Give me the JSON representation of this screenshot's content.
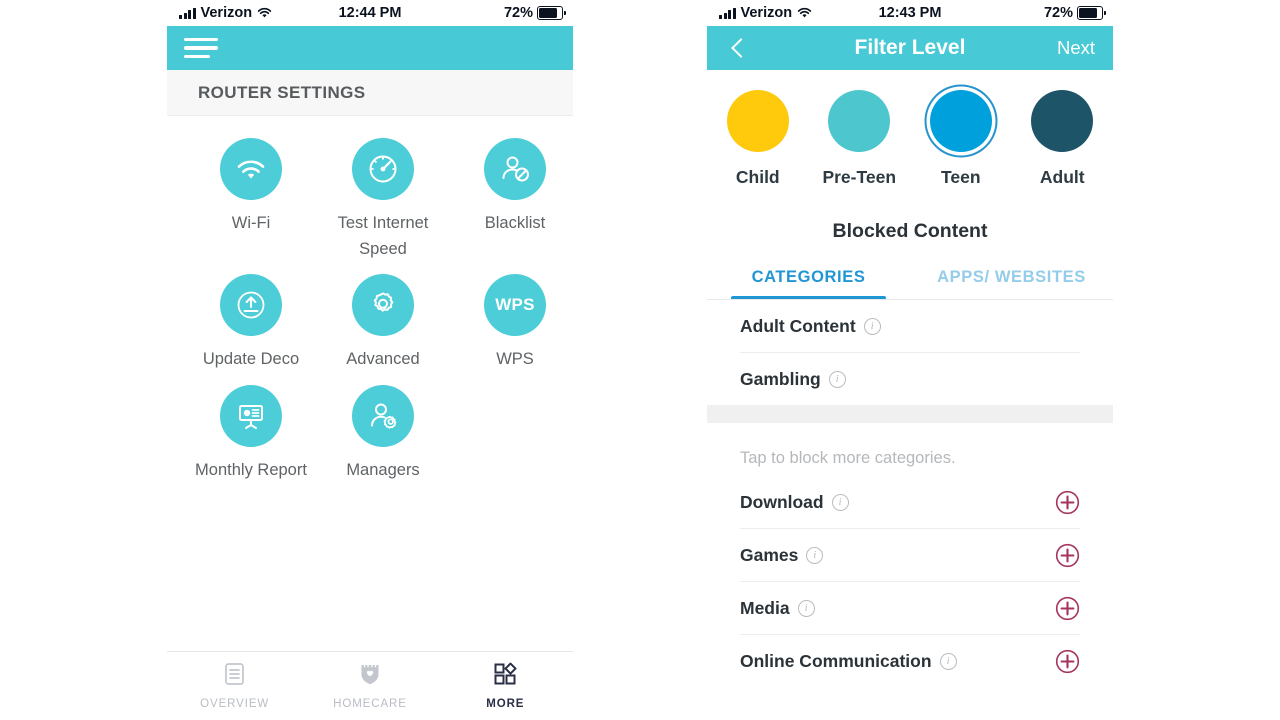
{
  "colors": {
    "teal_header": "#47c9d6",
    "teal_icon": "#4dcdd7",
    "accent_blue": "#2196d4",
    "child_yellow": "#ffc90c",
    "preteen_teal": "#4dc6ce",
    "teen_blue": "#00a0dc",
    "adult_dark": "#1d5468",
    "plus_magenta": "#a5335e",
    "band_gray": "#f0f0f0"
  },
  "left_phone": {
    "status_bar": {
      "carrier": "Verizon",
      "time": "12:44 PM",
      "battery": "72%",
      "signal_icon": "cellular-bars-icon",
      "wifi_icon": "wifi-icon",
      "battery_icon": "battery-icon"
    },
    "header": {
      "menu_icon": "hamburger-menu-icon"
    },
    "section_title": "ROUTER SETTINGS",
    "grid": [
      [
        {
          "label": "Wi-Fi",
          "icon": "wifi-icon"
        },
        {
          "label": "Test Internet Speed",
          "icon": "speedometer-icon"
        },
        {
          "label": "Blacklist",
          "icon": "user-blocked-icon"
        }
      ],
      [
        {
          "label": "Update Deco",
          "icon": "upload-circle-icon"
        },
        {
          "label": "Advanced",
          "icon": "gear-icon"
        },
        {
          "label": "WPS",
          "icon": "wps-text-icon",
          "text": "WPS"
        }
      ],
      [
        {
          "label": "Monthly Report",
          "icon": "presentation-chart-icon"
        },
        {
          "label": "Managers",
          "icon": "user-gear-icon"
        }
      ]
    ],
    "tabbar": [
      {
        "label": "OVERVIEW",
        "icon": "document-lines-icon",
        "active": false
      },
      {
        "label": "HOMECARE",
        "icon": "shield-heart-icon",
        "active": false
      },
      {
        "label": "MORE",
        "icon": "grid-squares-icon",
        "active": true
      }
    ]
  },
  "right_phone": {
    "status_bar": {
      "carrier": "Verizon",
      "time": "12:43 PM",
      "battery": "72%",
      "signal_icon": "cellular-bars-icon",
      "wifi_icon": "wifi-icon",
      "battery_icon": "battery-icon"
    },
    "header": {
      "back_icon": "chevron-left-icon",
      "title": "Filter Level",
      "next_label": "Next"
    },
    "levels": [
      {
        "name": "Child",
        "color": "#ffc90c",
        "selected": false
      },
      {
        "name": "Pre-Teen",
        "color": "#4dc6ce",
        "selected": false
      },
      {
        "name": "Teen",
        "color": "#00a0dc",
        "selected": true
      },
      {
        "name": "Adult",
        "color": "#1d5468",
        "selected": false
      }
    ],
    "blocked_title": "Blocked Content",
    "tabs": [
      {
        "label": "CATEGORIES",
        "active": true
      },
      {
        "label": "APPS/ WEBSITES",
        "active": false
      }
    ],
    "blocked_rows": [
      {
        "label": "Adult Content",
        "info_icon": "info-icon"
      },
      {
        "label": "Gambling",
        "info_icon": "info-icon"
      }
    ],
    "hint": "Tap to block more categories.",
    "available_rows": [
      {
        "label": "Download",
        "info_icon": "info-icon",
        "add_icon": "plus-circle-icon"
      },
      {
        "label": "Games",
        "info_icon": "info-icon",
        "add_icon": "plus-circle-icon"
      },
      {
        "label": "Media",
        "info_icon": "info-icon",
        "add_icon": "plus-circle-icon"
      },
      {
        "label": "Online Communication",
        "info_icon": "info-icon",
        "add_icon": "plus-circle-icon"
      }
    ]
  }
}
